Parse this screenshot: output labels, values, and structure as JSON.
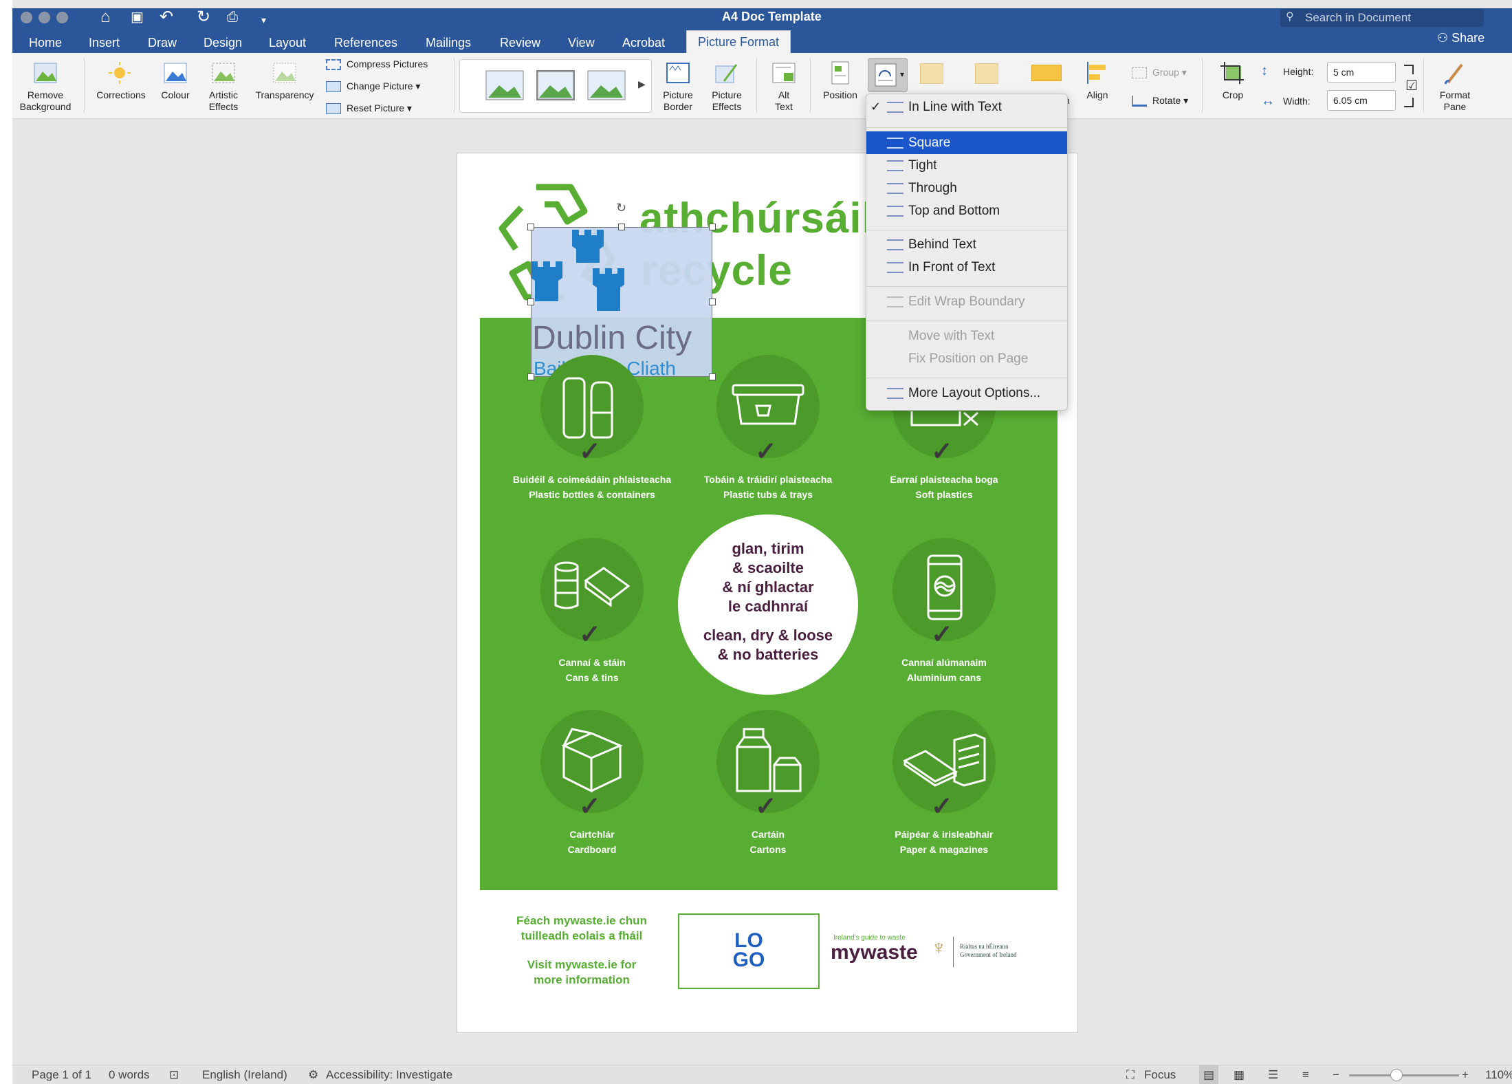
{
  "window": {
    "title": "A4 Doc Template",
    "search_placeholder": "Search in Document",
    "share_label": "Share"
  },
  "tabs": [
    "Home",
    "Insert",
    "Draw",
    "Design",
    "Layout",
    "References",
    "Mailings",
    "Review",
    "View",
    "Acrobat",
    "Picture Format"
  ],
  "active_tab": "Picture Format",
  "ribbon": {
    "remove_background": [
      "Remove",
      "Background"
    ],
    "corrections": "Corrections",
    "colour": "Colour",
    "artistic_effects": [
      "Artistic",
      "Effects"
    ],
    "transparency": "Transparency",
    "compress_pictures": "Compress Pictures",
    "change_picture": "Change Picture",
    "reset_picture": "Reset Picture",
    "picture_border": [
      "Picture",
      "Border"
    ],
    "picture_effects": [
      "Picture",
      "Effects"
    ],
    "alt_text": [
      "Alt",
      "Text"
    ],
    "position": "Position",
    "align": "Align",
    "group": "Group",
    "rotate": "Rotate",
    "crop": "Crop",
    "height_label": "Height:",
    "height_value": "5 cm",
    "width_label": "Width:",
    "width_value": "6.05 cm",
    "format_pane": [
      "Format",
      "Pane"
    ],
    "partial_label": "n"
  },
  "wrap_menu": {
    "items": [
      {
        "label": "In Line with Text",
        "checked": true,
        "state": "normal"
      },
      {
        "label": "Square",
        "state": "selected"
      },
      {
        "label": "Tight",
        "state": "normal"
      },
      {
        "label": "Through",
        "state": "normal"
      },
      {
        "label": "Top and Bottom",
        "state": "normal"
      },
      {
        "label": "Behind Text",
        "state": "normal"
      },
      {
        "label": "In Front of Text",
        "state": "normal"
      },
      {
        "label": "Edit Wrap Boundary",
        "state": "disabled"
      },
      {
        "label": "Move with Text",
        "state": "disabled"
      },
      {
        "label": "Fix Position on Page",
        "state": "disabled"
      },
      {
        "label": "More Layout Options...",
        "state": "normal"
      }
    ]
  },
  "poster": {
    "title_irish": "athchúrsáil",
    "title_english": "recycle",
    "city_name": "Dublin City",
    "city_irish": "Baile Átha Cliath",
    "center_irish": [
      "glan, tirim",
      "& scaoilte",
      "& ní ghlactar",
      "le cadhnraí"
    ],
    "center_english": [
      "clean, dry & loose",
      "& no batteries"
    ],
    "items": [
      {
        "irish": "Buidéil & coimeádáin phlaisteacha",
        "english": "Plastic bottles & containers"
      },
      {
        "irish": "Tobáin & tráidirí plaisteacha",
        "english": "Plastic tubs & trays"
      },
      {
        "irish": "Earraí plaisteacha boga",
        "english": "Soft plastics"
      },
      {
        "irish": "Cannaí & stáin",
        "english": "Cans & tins"
      },
      {
        "irish": "Cannaí alúmanaim",
        "english": "Aluminium cans"
      },
      {
        "irish": "Cairtchlár",
        "english": "Cardboard"
      },
      {
        "irish": "Cartáin",
        "english": "Cartons"
      },
      {
        "irish": "Páipéar & irisleabhair",
        "english": "Paper & magazines"
      }
    ],
    "footer_irish": [
      "Féach mywaste.ie chun",
      "tuilleadh eolais a fháil"
    ],
    "footer_english": [
      "Visit mywaste.ie for",
      "more information"
    ],
    "logo_text": [
      "LO",
      "GO"
    ],
    "mywaste_tagline": "Ireland's guide to waste",
    "mywaste_brand": "mywaste",
    "gov_irish": "Rialtas na hÉireann",
    "gov_english": "Government of Ireland"
  },
  "status": {
    "page": "Page 1 of 1",
    "words": "0 words",
    "language": "English (Ireland)",
    "accessibility": "Accessibility: Investigate",
    "focus": "Focus",
    "zoom": "110%"
  },
  "colors": {
    "ribbon_blue": "#2b579a",
    "poster_green": "#57ae32",
    "menu_highlight": "#1a56c9",
    "text_purple": "#4a1f3f"
  }
}
